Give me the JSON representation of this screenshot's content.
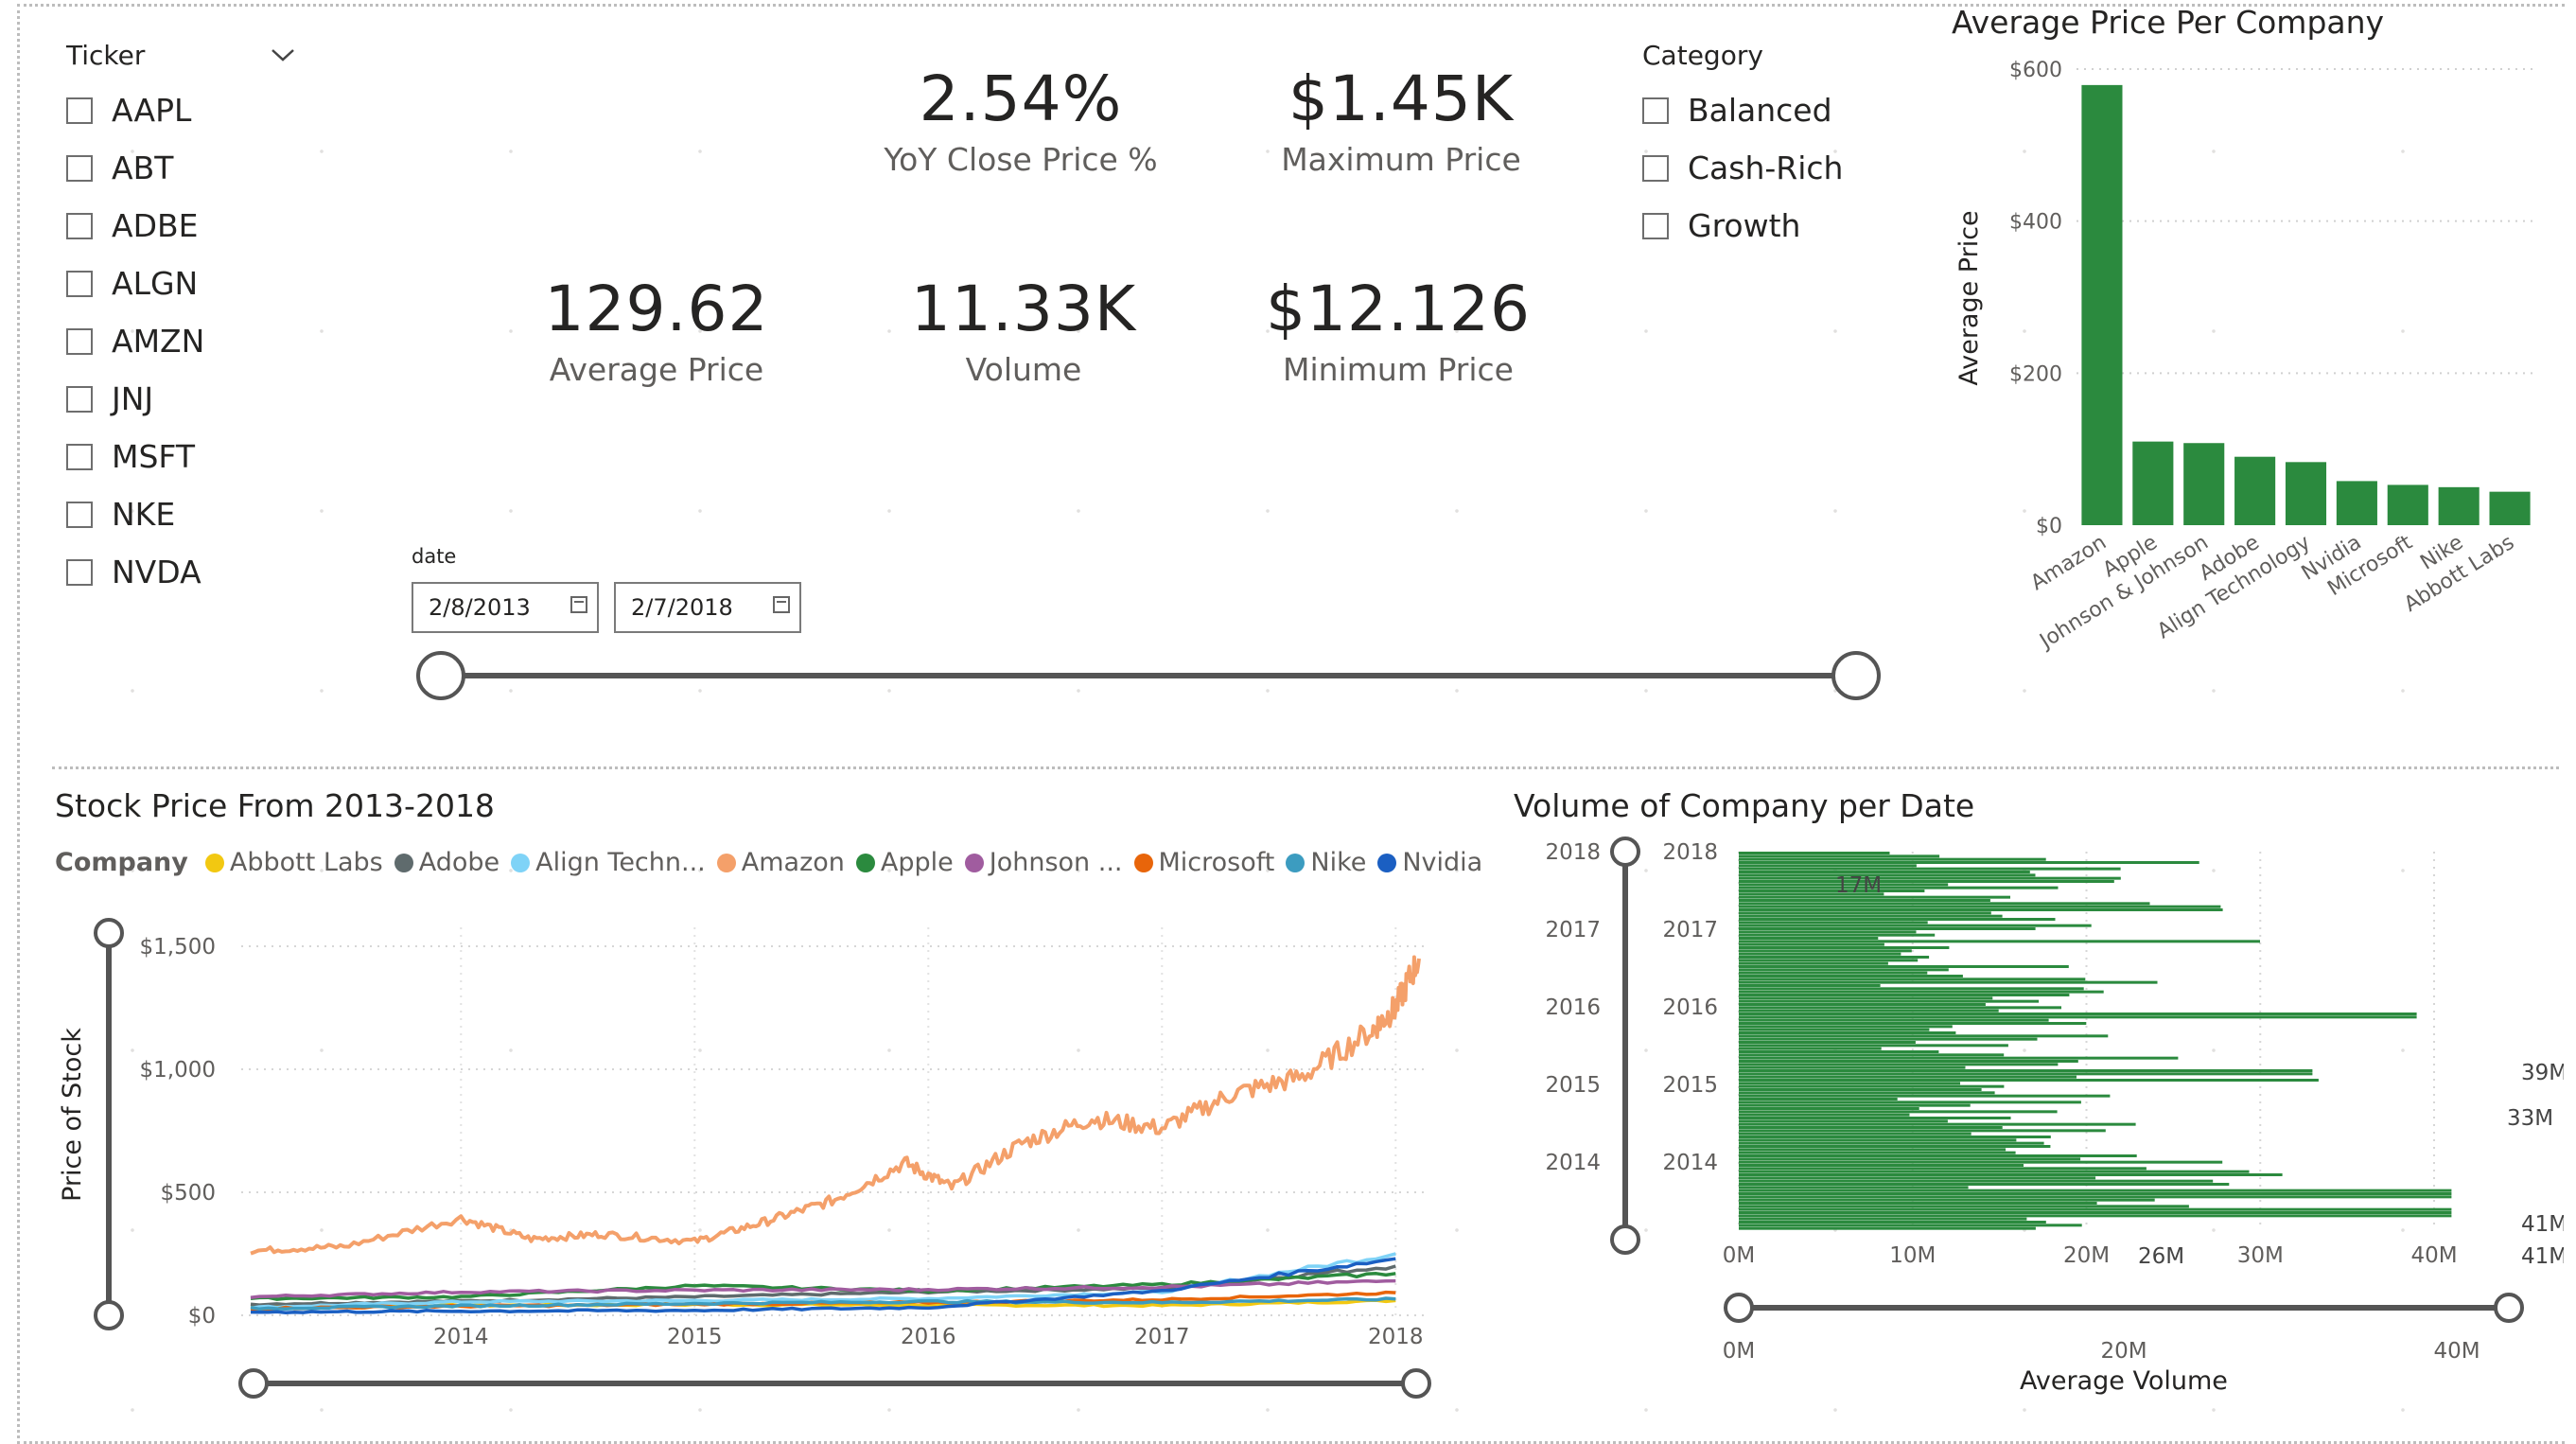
{
  "ticker_slicer": {
    "title": "Ticker",
    "items": [
      "AAPL",
      "ABT",
      "ADBE",
      "ALGN",
      "AMZN",
      "JNJ",
      "MSFT",
      "NKE",
      "NVDA"
    ]
  },
  "category_slicer": {
    "title": "Category",
    "items": [
      "Balanced",
      "Cash-Rich",
      "Growth"
    ]
  },
  "kpis": {
    "yoy": {
      "value": "2.54%",
      "label": "YoY Close Price %"
    },
    "max": {
      "value": "$1.45K",
      "label": "Maximum Price"
    },
    "avg": {
      "value": "129.62",
      "label": "Average Price"
    },
    "volume": {
      "value": "11.33K",
      "label": "Volume"
    },
    "min": {
      "value": "$12.126",
      "label": "Minimum Price"
    }
  },
  "date_slicer": {
    "label": "date",
    "start": "2/8/2013",
    "end": "2/7/2018"
  },
  "chart_data": [
    {
      "type": "bar",
      "title": "Average Price Per Company",
      "ylabel": "Average Price",
      "xlabel": "",
      "categories": [
        "Amazon",
        "Apple",
        "Johnson & Johnson",
        "Adobe",
        "Align Technology",
        "Nvidia",
        "Microsoft",
        "Nike",
        "Abbott Labs"
      ],
      "values": [
        579,
        110,
        108,
        90,
        83,
        58,
        53,
        50,
        44
      ],
      "ylim": [
        0,
        600
      ],
      "yticks": [
        "$0",
        "$200",
        "$400",
        "$600"
      ],
      "color": "#2b8a3e",
      "grid": true
    },
    {
      "type": "line",
      "title": "Stock Price From 2013-2018",
      "ylabel": "Price of Stock",
      "xlabel": "",
      "legend_title": "Company",
      "legend_position": "top",
      "x_ticks": [
        "2014",
        "2015",
        "2016",
        "2017",
        "2018"
      ],
      "y_ticks": [
        "$0",
        "$500",
        "$1,000",
        "$1,500"
      ],
      "ylim": [
        0,
        1500
      ],
      "series": [
        {
          "name": "Abbott Labs",
          "display_name": "Abbott Labs",
          "color": "#f2c811",
          "values": [
            [
              2013.1,
              38
            ],
            [
              2014,
              40
            ],
            [
              2015,
              44
            ],
            [
              2016,
              42
            ],
            [
              2017,
              40
            ],
            [
              2018,
              60
            ]
          ]
        },
        {
          "name": "Adobe",
          "display_name": "Adobe",
          "color": "#5f6b6d",
          "values": [
            [
              2013.1,
              45
            ],
            [
              2014,
              58
            ],
            [
              2015,
              75
            ],
            [
              2016,
              95
            ],
            [
              2017,
              110
            ],
            [
              2018,
              200
            ]
          ]
        },
        {
          "name": "Align Technology",
          "display_name": "Align Techn...",
          "color": "#7fd3f7",
          "values": [
            [
              2013.1,
              32
            ],
            [
              2014,
              55
            ],
            [
              2015,
              60
            ],
            [
              2016,
              68
            ],
            [
              2017,
              95
            ],
            [
              2018,
              250
            ]
          ]
        },
        {
          "name": "Amazon",
          "display_name": "Amazon",
          "color": "#f4a06a",
          "values": [
            [
              2013.1,
              262
            ],
            [
              2013.5,
              280
            ],
            [
              2014.0,
              395
            ],
            [
              2014.3,
              310
            ],
            [
              2014.6,
              330
            ],
            [
              2015.0,
              300
            ],
            [
              2015.3,
              380
            ],
            [
              2015.6,
              470
            ],
            [
              2015.9,
              620
            ],
            [
              2016.1,
              520
            ],
            [
              2016.4,
              700
            ],
            [
              2016.7,
              800
            ],
            [
              2017.0,
              760
            ],
            [
              2017.3,
              900
            ],
            [
              2017.6,
              970
            ],
            [
              2017.9,
              1160
            ],
            [
              2018.0,
              1250
            ],
            [
              2018.1,
              1450
            ]
          ]
        },
        {
          "name": "Apple",
          "display_name": "Apple",
          "color": "#2b8a3e",
          "values": [
            [
              2013.1,
              68
            ],
            [
              2014,
              75
            ],
            [
              2015,
              120
            ],
            [
              2016,
              100
            ],
            [
              2017,
              125
            ],
            [
              2018,
              170
            ]
          ]
        },
        {
          "name": "Johnson & Johnson",
          "display_name": "Johnson ...",
          "color": "#a05c9f",
          "values": [
            [
              2013.1,
              75
            ],
            [
              2014,
              95
            ],
            [
              2015,
              102
            ],
            [
              2016,
              105
            ],
            [
              2017,
              115
            ],
            [
              2018,
              140
            ]
          ]
        },
        {
          "name": "Microsoft",
          "display_name": "Microsoft",
          "color": "#e8650a",
          "values": [
            [
              2013.1,
              28
            ],
            [
              2014,
              37
            ],
            [
              2015,
              45
            ],
            [
              2016,
              52
            ],
            [
              2017,
              64
            ],
            [
              2018,
              92
            ]
          ]
        },
        {
          "name": "Nike",
          "display_name": "Nike",
          "color": "#3c9cc0",
          "values": [
            [
              2013.1,
              28
            ],
            [
              2014,
              38
            ],
            [
              2015,
              48
            ],
            [
              2016,
              56
            ],
            [
              2017,
              52
            ],
            [
              2018,
              66
            ]
          ]
        },
        {
          "name": "Nvidia",
          "display_name": "Nvidia",
          "color": "#1b5fc2",
          "values": [
            [
              2013.1,
              13
            ],
            [
              2014,
              17
            ],
            [
              2015,
              20
            ],
            [
              2016,
              32
            ],
            [
              2017,
              100
            ],
            [
              2018,
              230
            ]
          ]
        }
      ]
    },
    {
      "type": "bar",
      "orientation": "horizontal",
      "title": "Volume of Company per Date",
      "xlabel": "Average Volume",
      "y_ticks": [
        "2018",
        "2017",
        "2016",
        "2015",
        "2014"
      ],
      "x_ticks": [
        "0M",
        "10M",
        "20M",
        "30M",
        "40M"
      ],
      "slider_x_ticks": [
        "0M",
        "20M",
        "40M"
      ],
      "xlim": [
        0,
        48
      ],
      "data_labels": [
        "17M",
        "39M",
        "33M",
        "41M",
        "41M",
        "26M"
      ],
      "color": "#2b8a3e"
    }
  ]
}
